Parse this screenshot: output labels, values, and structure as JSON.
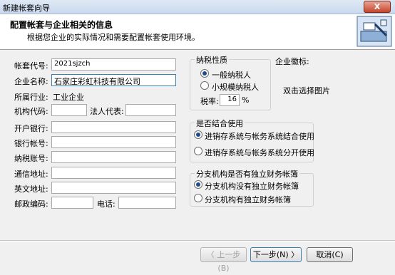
{
  "window": {
    "title": "新建帐套向导",
    "close": "X"
  },
  "header": {
    "title": "配置帐套与企业相关的信息",
    "subtitle": "根据您企业的实际情况和需要配置帐套使用环境。"
  },
  "form": {
    "account_code_label": "帐套代号:",
    "account_code_value": "2021sjzch",
    "company_name_label": "企业名称:",
    "company_name_value": "石家庄彩虹科技有限公司",
    "industry_label": "所属行业:",
    "industry_value": "工业企业",
    "org_code_label": "机构代码:",
    "legal_rep_label": "法人代表:",
    "bank_label": "开户银行:",
    "bank_account_label": "银行帐号:",
    "tax_no_label": "纳税账号:",
    "address_label": "通信地址:",
    "en_address_label": "英文地址:",
    "postcode_label": "邮政编码:",
    "phone_label": "电话:"
  },
  "tax_group": {
    "title": "纳税性质",
    "option_general": "一般纳税人",
    "option_small": "小规模纳税人",
    "selected": "一般纳税人",
    "rate_label": "税率:",
    "rate_value": "16",
    "percent": "%"
  },
  "logo": {
    "label": "企业徽标:",
    "hint": "双击选择图片"
  },
  "combine_group": {
    "title": "是否结合使用",
    "option_combined": "进销存系统与帐务系统结合使用",
    "option_separate": "进销存系统与帐务系统分开使用",
    "selected": "进销存系统与帐务系统结合使用"
  },
  "branch_group": {
    "title": "分支机构是否有独立财务帐簿",
    "option_no": "分支机构没有独立财务帐簿",
    "option_yes": "分支机构有独立财务帐簿",
    "selected": "分支机构没有独立财务帐簿"
  },
  "buttons": {
    "prev": "〈 上一步(B)",
    "next": "下一步(N) 〉",
    "cancel": "取消(C)"
  }
}
